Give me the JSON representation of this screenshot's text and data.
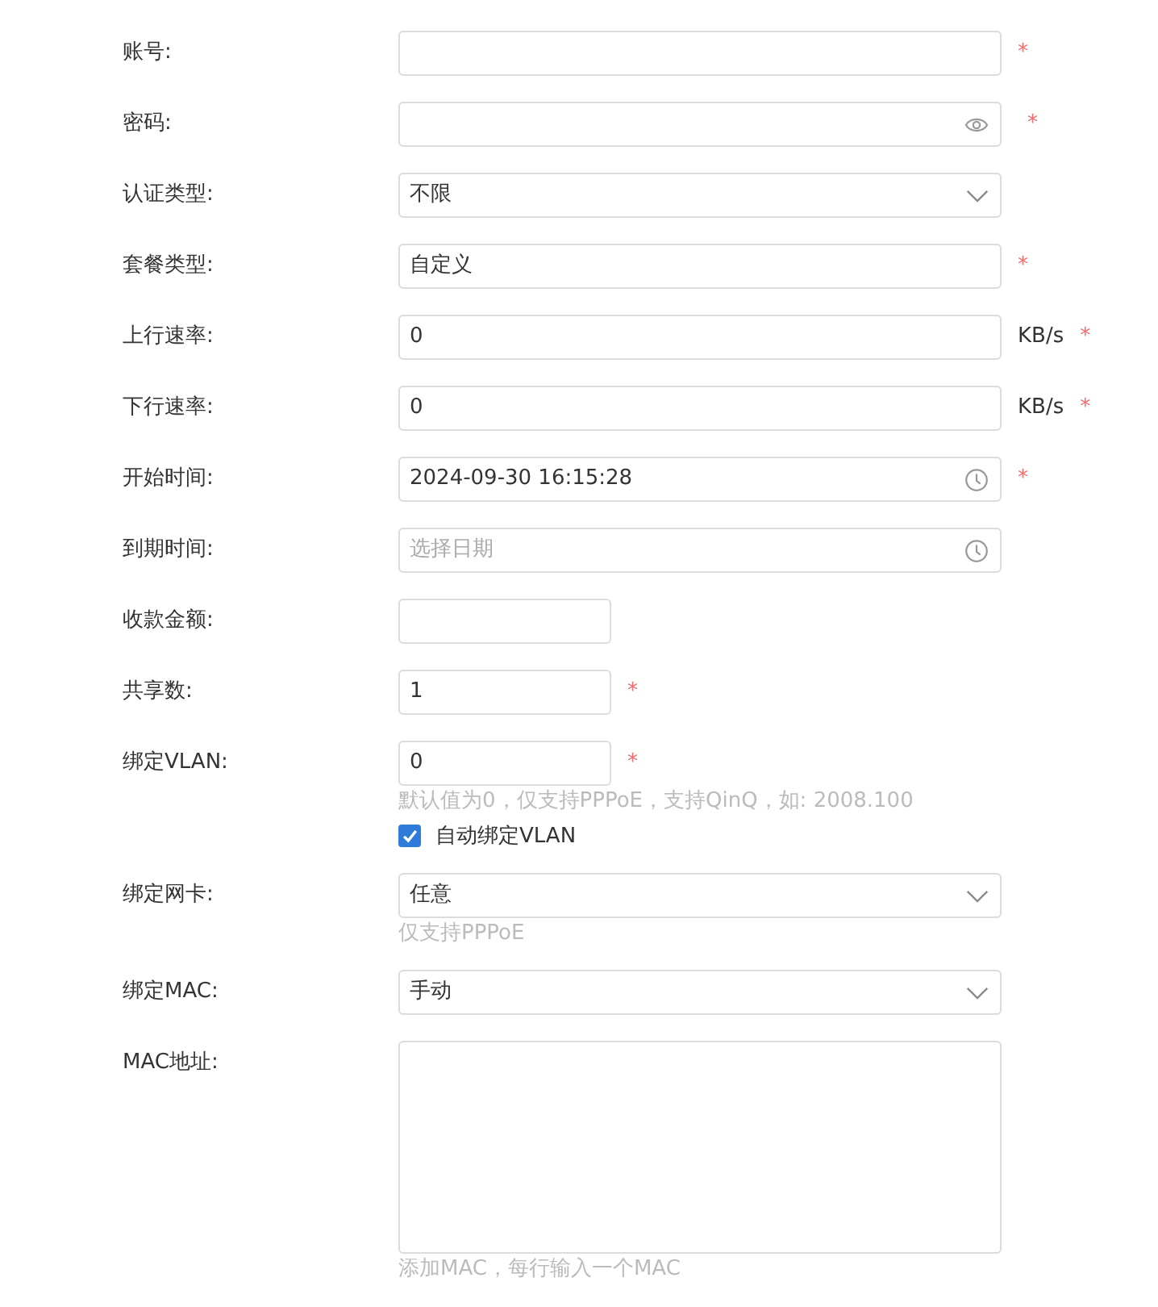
{
  "fields": [
    {
      "label": "账号:",
      "kind": "text",
      "short": false,
      "required_mark": "*"
    },
    {
      "label": "密码:",
      "kind": "password",
      "short": false,
      "required_mark": "*"
    },
    {
      "label": "认证类型:",
      "kind": "select",
      "short": false,
      "value": "不限"
    },
    {
      "label": "套餐类型:",
      "kind": "text",
      "short": false,
      "value": "自定义",
      "required_mark": "*"
    },
    {
      "label": "上行速率:",
      "kind": "text",
      "short": false,
      "value": "0",
      "unit": "KB/s",
      "required_mark": "*"
    },
    {
      "label": "下行速率:",
      "kind": "text",
      "short": false,
      "value": "0",
      "unit": "KB/s",
      "required_mark": "*"
    },
    {
      "label": "开始时间:",
      "kind": "date",
      "short": false,
      "value": "2024-09-30 16:15:28",
      "required_mark": "*"
    },
    {
      "label": "到期时间:",
      "kind": "date",
      "short": false,
      "placeholder": "选择日期"
    },
    {
      "label": "收款金额:",
      "kind": "text",
      "short": true
    },
    {
      "label": "共享数:",
      "kind": "text",
      "short": true,
      "value": "1",
      "required_mark": "*"
    },
    {
      "label": "绑定VLAN:",
      "kind": "text",
      "short": true,
      "value": "0",
      "required_mark": "*",
      "hint": "默认值为0，仅支持PPPoE，支持QinQ，如: 2008.100",
      "checkbox": {
        "label": "自动绑定VLAN",
        "checked": true
      }
    },
    {
      "label": "绑定网卡:",
      "kind": "select",
      "short": false,
      "value": "任意",
      "hint": "仅支持PPPoE"
    },
    {
      "label": "绑定MAC:",
      "kind": "select",
      "short": false,
      "value": "手动"
    },
    {
      "label": "MAC地址:",
      "kind": "textarea",
      "short": false,
      "hint": "添加MAC，每行输入一个MAC"
    }
  ]
}
